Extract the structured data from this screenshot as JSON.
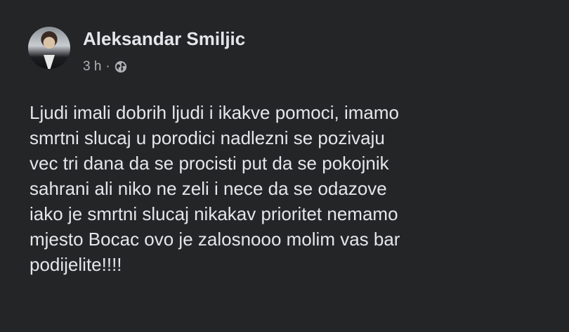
{
  "post": {
    "author": "Aleksandar Smiljic",
    "timestamp": "3 h",
    "separator": "·",
    "audience_icon": "globe-icon",
    "text": "Ljudi imali dobrih ljudi i ikakve pomoci, imamo\nsmrtni slucaj u porodici nadlezni se pozivaju\nvec tri dana da se procisti put da se pokojnik\nsahrani ali niko ne zeli i nece da se odazove\niako je smrtni slucaj nikakav prioritet nemamo\nmjesto Bocac ovo je zalosnooo molim vas bar\npodijelite!!!!"
  },
  "colors": {
    "background": "#242526",
    "primary_text": "#e4e6eb",
    "secondary_text": "#b0b3b8"
  }
}
